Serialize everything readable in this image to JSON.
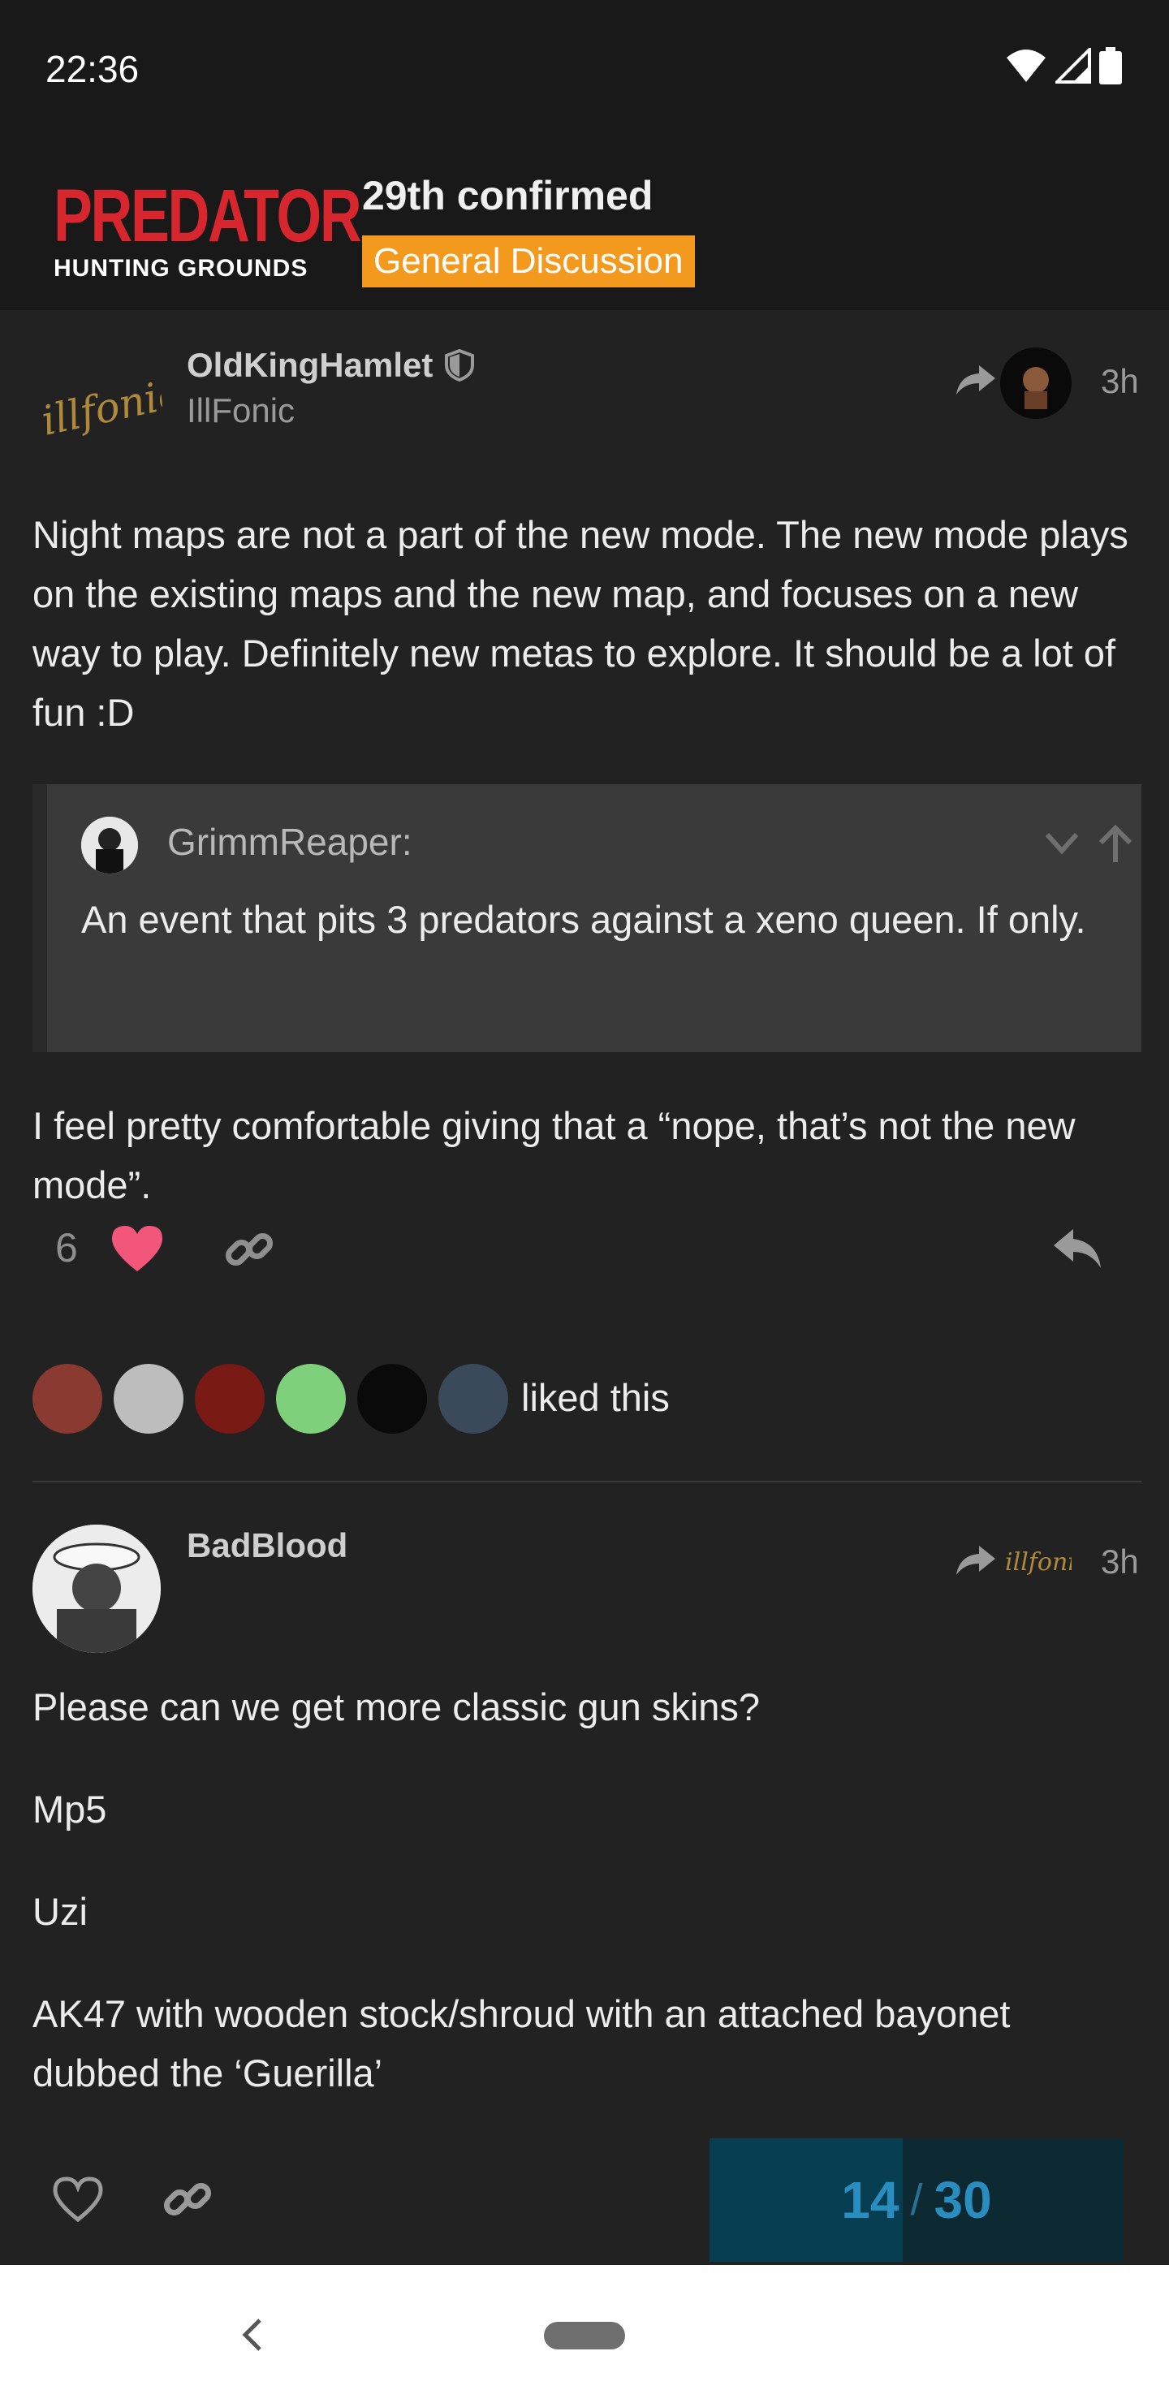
{
  "status_bar": {
    "time": "22:36"
  },
  "header": {
    "logo_top": "PREDATOR",
    "logo_bottom": "HUNTING GROUNDS",
    "topic_title": "29th confirmed",
    "category": "General Discussion",
    "category_color": "#f39a1e"
  },
  "post1": {
    "username": "OldKingHamlet",
    "user_title": "IllFonic",
    "avatar_text": "illfonic",
    "time": "3h",
    "paragraph1": "Night maps are not a part of the new mode. The new mode plays on the existing maps and the new map, and focuses on a new way to play. Definitely new metas to explore. It should be a lot of fun :D",
    "quote": {
      "username": "GrimmReaper:",
      "text": "An event that pits 3 predators against a xeno queen. If only."
    },
    "paragraph2": "I feel pretty comfortable giving that a “nope, that’s not the new mode”.",
    "like_count": "6",
    "liked_text": "liked this"
  },
  "post2": {
    "username": "BadBlood",
    "time": "3h",
    "reply_to_avatar_text": "illfonic",
    "lines": [
      "Please can we get more classic gun skins?",
      "Mp5",
      "Uzi",
      "AK47 with wooden stock/shroud with an attached bayonet dubbed the ‘Guerilla’"
    ]
  },
  "progress": {
    "current": "14",
    "total": "30",
    "fraction": 0.4667
  },
  "colors": {
    "accent": "#f39a1e",
    "like_heart": "#f2567a",
    "brand_red": "#d7262e",
    "progress": "#2a8dc0"
  }
}
